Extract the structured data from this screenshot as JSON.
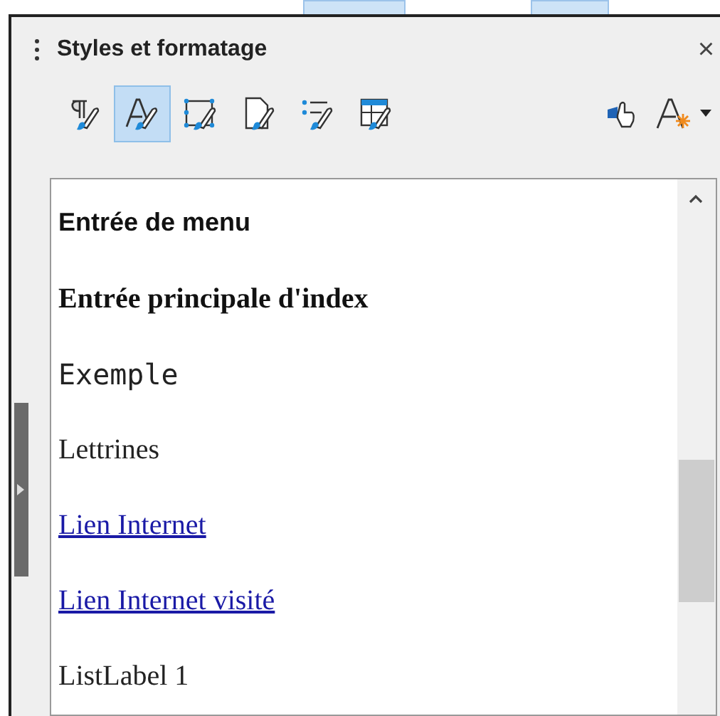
{
  "panel": {
    "title": "Styles et formatage",
    "close": "×"
  },
  "categories": [
    {
      "kind": "paragraph",
      "selected": false
    },
    {
      "kind": "character",
      "selected": true
    },
    {
      "kind": "frame",
      "selected": false
    },
    {
      "kind": "page",
      "selected": false
    },
    {
      "kind": "list",
      "selected": false
    },
    {
      "kind": "table",
      "selected": false
    }
  ],
  "styles": [
    {
      "name": "Entrée de menu",
      "kind": "sans-bold"
    },
    {
      "name": "Entrée principale d'index",
      "kind": "serif-bold"
    },
    {
      "name": "Exemple",
      "kind": "mono"
    },
    {
      "name": "Lettrines",
      "kind": "serif"
    },
    {
      "name": "Lien Internet",
      "kind": "link"
    },
    {
      "name": "Lien Internet visité",
      "kind": "link"
    },
    {
      "name": "ListLabel 1",
      "kind": "serif"
    }
  ]
}
